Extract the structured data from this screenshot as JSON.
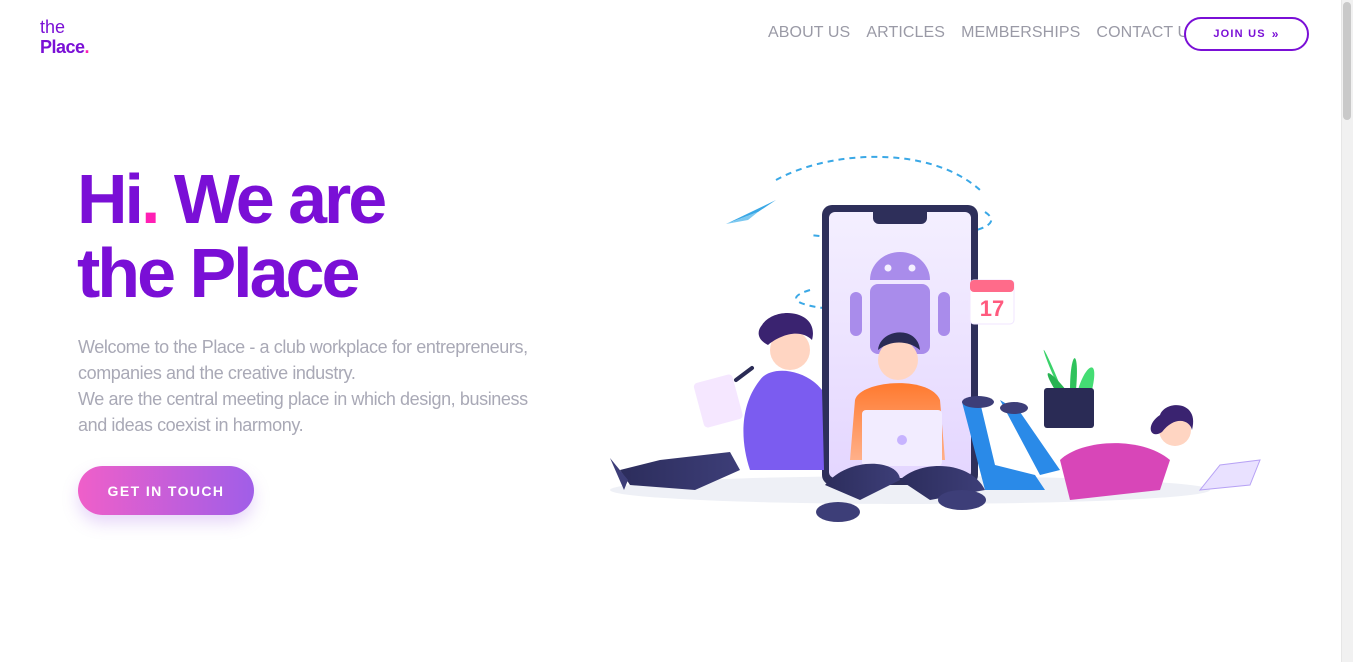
{
  "logo": {
    "line1": "the",
    "line2": "Place",
    "dot": "."
  },
  "nav": {
    "items": [
      "ABOUT US",
      "ARTICLES",
      "MEMBERSHIPS",
      "CONTACT US"
    ],
    "join_label": "JOIN US",
    "join_icon": "double-chevron-right-icon"
  },
  "hero": {
    "title_part1": "Hi",
    "title_dot": ".",
    "title_part2": " We are",
    "title_line2": "the Place",
    "desc_line1": "Welcome to the Place - a club workplace for entrepreneurs,",
    "desc_line2": "companies and the creative industry.",
    "desc_line3": "We are the central meeting place in which design, business",
    "desc_line4": "and ideas coexist in harmony.",
    "cta_label": "GET IN TOUCH"
  },
  "illustration": {
    "calendar_day": "17"
  },
  "colors": {
    "brand": "#7a0fd6",
    "accent_dot": "#ff1fb4",
    "nav_text": "#9a9aa6",
    "desc_text": "#a9a9b6",
    "cta_gradient_start": "#ef5fc9",
    "cta_gradient_end": "#a05ee8"
  }
}
